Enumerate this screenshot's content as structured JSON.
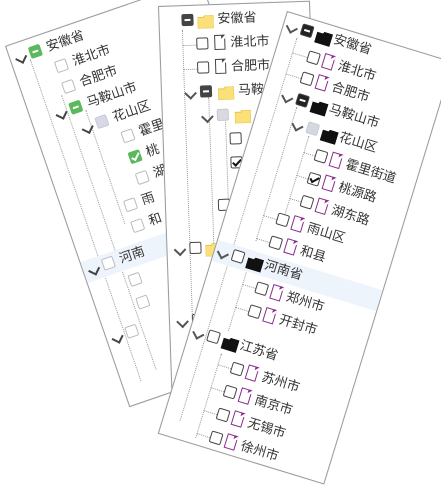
{
  "card1": {
    "rows": [
      {
        "label": "安徽省",
        "state": "partial"
      },
      {
        "label": "淮北市",
        "state": "none"
      },
      {
        "label": "合肥市",
        "state": "none"
      },
      {
        "label": "马鞍山市",
        "state": "partial"
      },
      {
        "label": "花山区",
        "state": "gray"
      },
      {
        "label": "霍里",
        "state": "none"
      },
      {
        "label": "桃",
        "state": "checked"
      },
      {
        "label": "湖",
        "state": "none"
      },
      {
        "label": "雨",
        "state": "none"
      },
      {
        "label": "和",
        "state": "none"
      },
      {
        "label": "河南",
        "state": "none"
      }
    ]
  },
  "card2": {
    "rows": [
      {
        "label": "安徽省",
        "state": "partial"
      },
      {
        "label": "淮北市",
        "state": "none"
      },
      {
        "label": "合肥市",
        "state": "none"
      },
      {
        "label": "马鞍",
        "state": "partial"
      },
      {
        "label": "",
        "state": "gray"
      },
      {
        "label": "",
        "state": "none"
      },
      {
        "label": "",
        "state": "checked"
      },
      {
        "label": "",
        "state": "none"
      }
    ]
  },
  "card3": {
    "rows": [
      {
        "label": "安徽省",
        "state": "partial"
      },
      {
        "label": "淮北市",
        "state": "none"
      },
      {
        "label": "合肥市",
        "state": "none"
      },
      {
        "label": "马鞍山市",
        "state": "partial"
      },
      {
        "label": "花山区",
        "state": "gray"
      },
      {
        "label": "霍里街道",
        "state": "none"
      },
      {
        "label": "桃源路",
        "state": "checked"
      },
      {
        "label": "湖东路",
        "state": "none"
      },
      {
        "label": "雨山区",
        "state": "none"
      },
      {
        "label": "和县",
        "state": "none"
      },
      {
        "label": "河南省",
        "state": "none"
      },
      {
        "label": "郑州市",
        "state": "none"
      },
      {
        "label": "开封市",
        "state": "none"
      },
      {
        "label": "江苏省",
        "state": "none"
      },
      {
        "label": "苏州市",
        "state": "none"
      },
      {
        "label": "南京市",
        "state": "none"
      },
      {
        "label": "无锡市",
        "state": "none"
      },
      {
        "label": "徐州市",
        "state": "none"
      }
    ]
  }
}
